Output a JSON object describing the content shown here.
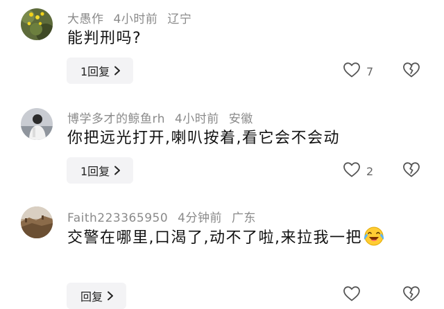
{
  "comments": [
    {
      "username": "大愚作",
      "time": "4小时前",
      "location": "辽宁",
      "text": "能判刑吗?",
      "reply_label": "1回复",
      "like_count": "7"
    },
    {
      "username": "博学多才的鲸鱼rh",
      "time": "4小时前",
      "location": "安徽",
      "text": "你把远光打开,喇叭按着,看它会不会动",
      "reply_label": "1回复",
      "like_count": "2"
    },
    {
      "username": "Faith223365950",
      "time": "4分钟前",
      "location": "广东",
      "text": "交警在哪里,口渴了,动不了啦,来拉我一把",
      "reply_label": "回复",
      "like_count": ""
    }
  ],
  "icons": {
    "like": "heart-outline-icon",
    "dislike": "broken-heart-icon",
    "reply_chevron": "chevron-right-icon",
    "emoji": "laughing-crying-emoji"
  },
  "colors": {
    "meta_text": "#8a8a8a",
    "body_text": "#111111",
    "button_bg": "#f3f3f5",
    "icon_stroke": "#555555"
  }
}
